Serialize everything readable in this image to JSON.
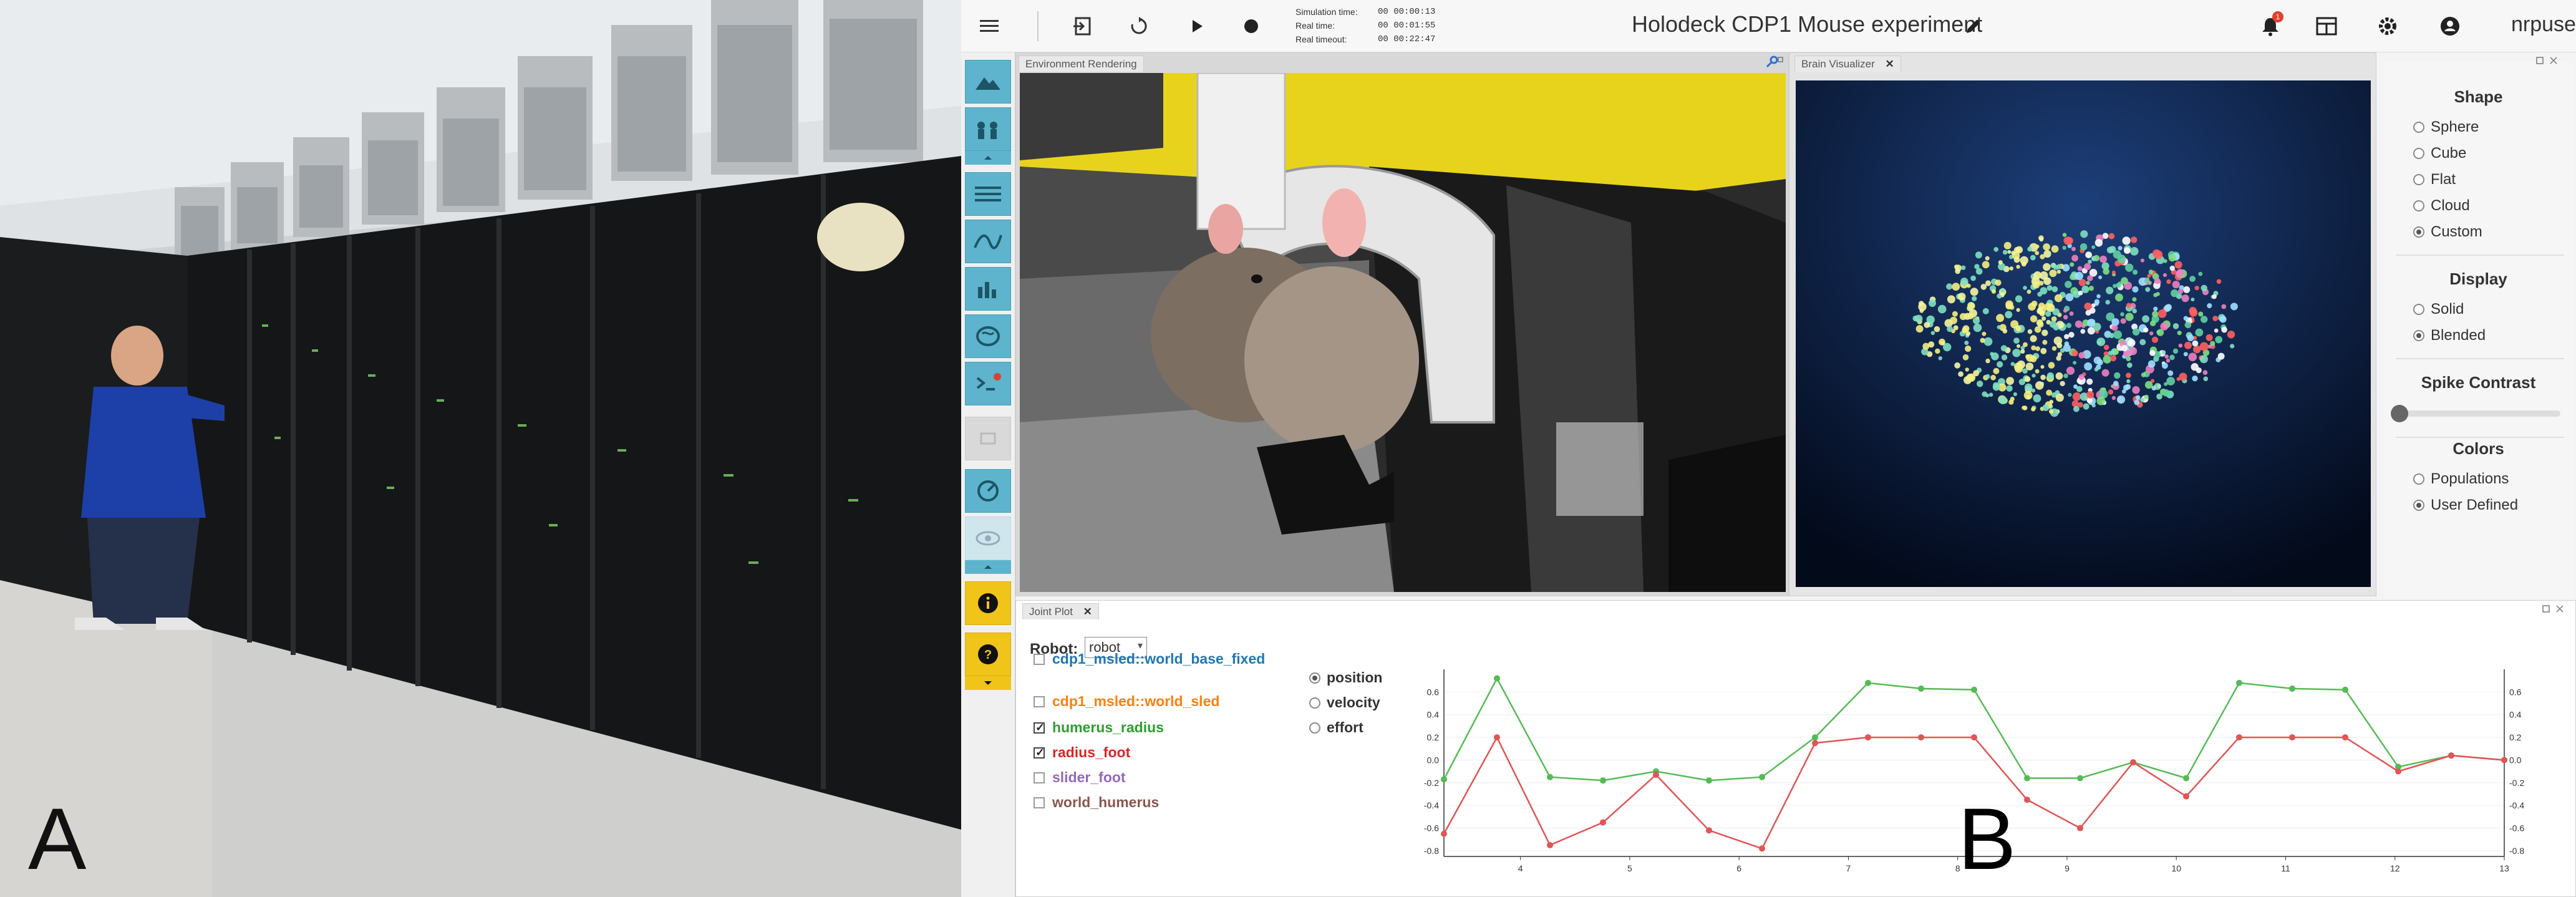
{
  "figure": {
    "label_a": "A",
    "label_b": "B"
  },
  "topbar": {
    "sim_labels": [
      "Simulation time:",
      "Real time:",
      "Real timeout:"
    ],
    "sim_values": [
      "00 00:00:13",
      "00 00:01:55",
      "00 00:22:47"
    ],
    "title": "Holodeck CDP1 Mouse experiment",
    "notification_count": "1",
    "user": "nrpuser"
  },
  "panes": {
    "env_tab": "Environment Rendering",
    "brain_tab": "Brain Visualizer",
    "plot_tab": "Joint Plot"
  },
  "brain_controls": {
    "shape_title": "Shape",
    "shape_options": [
      "Sphere",
      "Cube",
      "Flat",
      "Cloud",
      "Custom"
    ],
    "shape_selected": "Custom",
    "display_title": "Display",
    "display_options": [
      "Solid",
      "Blended"
    ],
    "display_selected": "Blended",
    "spike_title": "Spike Contrast",
    "spike_contrast": 0.0,
    "colors_title": "Colors",
    "color_options": [
      "Populations",
      "User Defined"
    ],
    "color_selected": "User Defined"
  },
  "joint_plot": {
    "robot_label": "Robot:",
    "robot_value": "robot",
    "joints": [
      {
        "name": "cdp1_msled::world_base_fixed",
        "checked": false,
        "color": "#1f77b4"
      },
      {
        "name": "cdp1_msled::world_sled",
        "checked": false,
        "color": "#ff7f0e"
      },
      {
        "name": "humerus_radius",
        "checked": true,
        "color": "#2ca02c"
      },
      {
        "name": "radius_foot",
        "checked": true,
        "color": "#d62728"
      },
      {
        "name": "slider_foot",
        "checked": false,
        "color": "#9467bd"
      },
      {
        "name": "world_humerus",
        "checked": false,
        "color": "#8c564b"
      }
    ],
    "modes": [
      "position",
      "velocity",
      "effort"
    ],
    "mode_selected": "position"
  },
  "chart_data": {
    "type": "line",
    "x": [
      3.5,
      4,
      4.5,
      5,
      5.5,
      6,
      6.5,
      7,
      7.5,
      8,
      8.5,
      9,
      9.5,
      10,
      10.5,
      11,
      11.5,
      12,
      12.5,
      13
    ],
    "series": [
      {
        "name": "humerus_radius",
        "color": "#55bb55",
        "values": [
          -0.17,
          0.72,
          -0.15,
          -0.18,
          -0.1,
          -0.18,
          -0.15,
          0.2,
          0.68,
          0.63,
          0.62,
          -0.16,
          -0.16,
          -0.02,
          -0.16,
          0.68,
          0.63,
          0.62,
          -0.06,
          0.04,
          0.0
        ]
      },
      {
        "name": "radius_foot",
        "color": "#e05555",
        "values": [
          -0.65,
          0.2,
          -0.75,
          -0.55,
          -0.13,
          -0.62,
          -0.78,
          0.15,
          0.2,
          0.2,
          0.2,
          -0.35,
          -0.6,
          -0.02,
          -0.32,
          0.2,
          0.2,
          0.2,
          -0.1,
          0.04,
          0.0
        ]
      }
    ],
    "x_ticks": [
      "4",
      "5",
      "6",
      "7",
      "8",
      "9",
      "10",
      "11",
      "12",
      "13"
    ],
    "y_ticks": [
      "-0.8",
      "-0.6",
      "-0.4",
      "-0.2",
      "0.0",
      "0.2",
      "0.4",
      "0.6"
    ],
    "ylim": [
      -0.85,
      0.8
    ],
    "xlim": [
      3.3,
      13
    ]
  }
}
